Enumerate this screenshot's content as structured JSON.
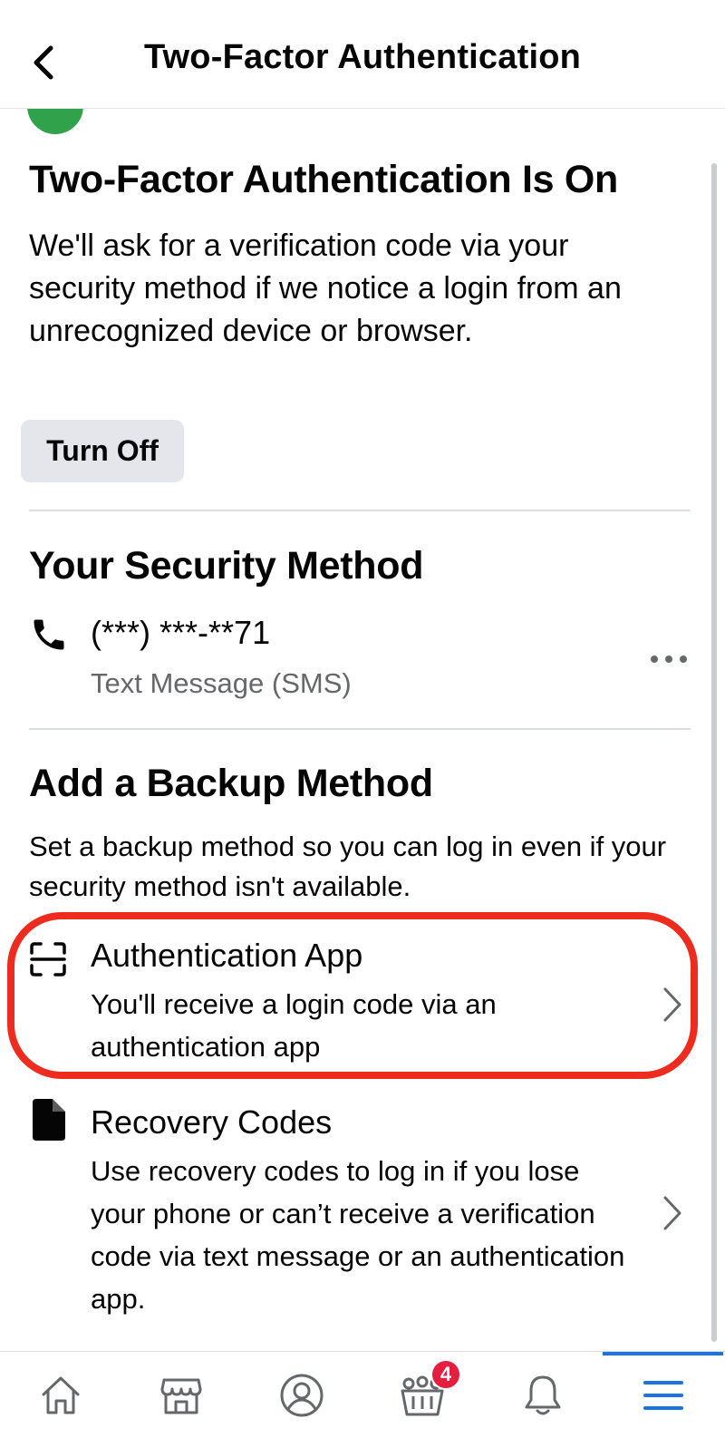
{
  "header": {
    "title": "Two-Factor Authentication",
    "back_icon": "chevron-left-icon"
  },
  "status": {
    "heading": "Two-Factor Authentication Is On",
    "description": "We'll ask for a verification code via your security method if we notice a login from an unrecognized device or browser.",
    "turn_off_label": "Turn Off",
    "icon_color": "#31a24c"
  },
  "security_method": {
    "heading": "Your Security Method",
    "phone": "(***) ***-**71",
    "type": "Text Message (SMS)",
    "icon": "phone-icon"
  },
  "backup": {
    "heading": "Add a Backup Method",
    "description": "Set a backup method so you can log in even if your security method isn't available.",
    "options": [
      {
        "title": "Authentication App",
        "description": "You'll receive a login code via an authentication app",
        "icon": "scan-icon"
      },
      {
        "title": "Recovery Codes",
        "description": "Use recovery codes to log in if you lose your phone or can’t receive a verification code via text message or an authentication app.",
        "icon": "document-icon"
      }
    ]
  },
  "tabbar": {
    "tabs": [
      "home-icon",
      "marketplace-icon",
      "profile-icon",
      "groups-icon",
      "notifications-icon",
      "menu-icon"
    ],
    "groups_badge": "4",
    "active_tab": "menu-icon",
    "accent_color": "#1b74e4"
  },
  "highlight_color": "#ee2b1f"
}
